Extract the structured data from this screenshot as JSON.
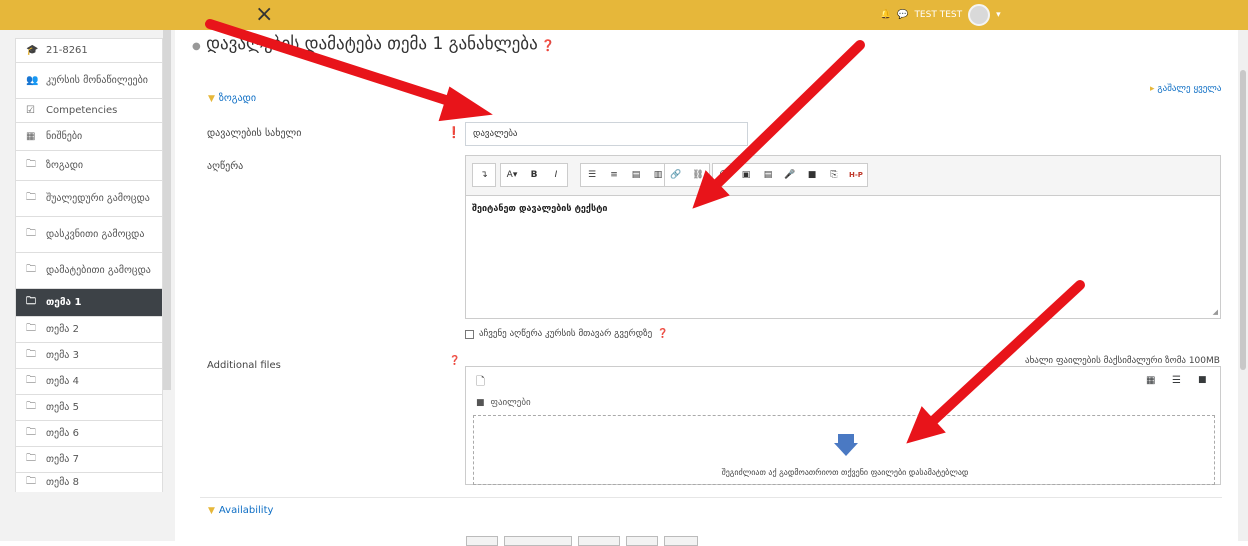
{
  "topbar": {
    "close_icon": "×",
    "user_name": "TEST TEST",
    "bell_icon": "bell-icon",
    "chat_icon": "chat-icon",
    "dropdown_icon": "chevron-down-icon"
  },
  "sidebar": {
    "items": [
      {
        "icon": "graduation-cap-icon",
        "glyph": "🎓",
        "label": "21-8261",
        "active": false
      },
      {
        "icon": "users-icon",
        "glyph": "👥",
        "label": "კურსის მონაწილეები",
        "active": false
      },
      {
        "icon": "checkbox-icon",
        "glyph": "☑",
        "label": "Competencies",
        "active": false
      },
      {
        "icon": "table-icon",
        "glyph": "▦",
        "label": "ნიშნები",
        "active": false
      },
      {
        "icon": "folder-icon",
        "glyph": "🗀",
        "label": "ზოგადი",
        "active": false
      },
      {
        "icon": "folder-icon",
        "glyph": "🗀",
        "label": "შუალედური გამოცდა",
        "active": false
      },
      {
        "icon": "folder-icon",
        "glyph": "🗀",
        "label": "დასკვნითი გამოცდა",
        "active": false
      },
      {
        "icon": "folder-icon",
        "glyph": "🗀",
        "label": "დამატებითი გამოცდა",
        "active": false
      },
      {
        "icon": "folder-icon",
        "glyph": "🗀",
        "label": "თემა 1",
        "active": true
      },
      {
        "icon": "folder-icon",
        "glyph": "🗀",
        "label": "თემა 2",
        "active": false
      },
      {
        "icon": "folder-icon",
        "glyph": "🗀",
        "label": "თემა 3",
        "active": false
      },
      {
        "icon": "folder-icon",
        "glyph": "🗀",
        "label": "თემა 4",
        "active": false
      },
      {
        "icon": "folder-icon",
        "glyph": "🗀",
        "label": "თემა 5",
        "active": false
      },
      {
        "icon": "folder-icon",
        "glyph": "🗀",
        "label": "თემა 6",
        "active": false
      },
      {
        "icon": "folder-icon",
        "glyph": "🗀",
        "label": "თემა 7",
        "active": false
      },
      {
        "icon": "folder-icon",
        "glyph": "🗀",
        "label": "თემა 8",
        "active": false
      }
    ]
  },
  "main": {
    "title": "დავალების დამატება თემა 1 განახლება",
    "expand_all": "გაშალე ყველა",
    "section_general": "ზოგადი",
    "name_label": "დავალების სახელი",
    "name_value": "დავალება",
    "desc_label": "აღწერა",
    "editor_text": "შეიტანეთ დავალების ტექსტი",
    "show_desc_label": "აჩვენე აღწერა კურსის მთავარ გვერდზე",
    "files_label": "Additional files",
    "max_size": "ახალი ფაილების მაქსიმალური ზომა 100MB",
    "folder_label": "ფაილები",
    "dropzone_text": "შეგიძლიათ აქ გადმოათრიოთ თქვენი ფაილები დასამატებლად",
    "section_availability": "Availability"
  },
  "colors": {
    "topbar": "#e6b73a",
    "active_nav": "#3d4247",
    "link": "#0f6fc5",
    "annotation_arrow": "#e8141a"
  }
}
